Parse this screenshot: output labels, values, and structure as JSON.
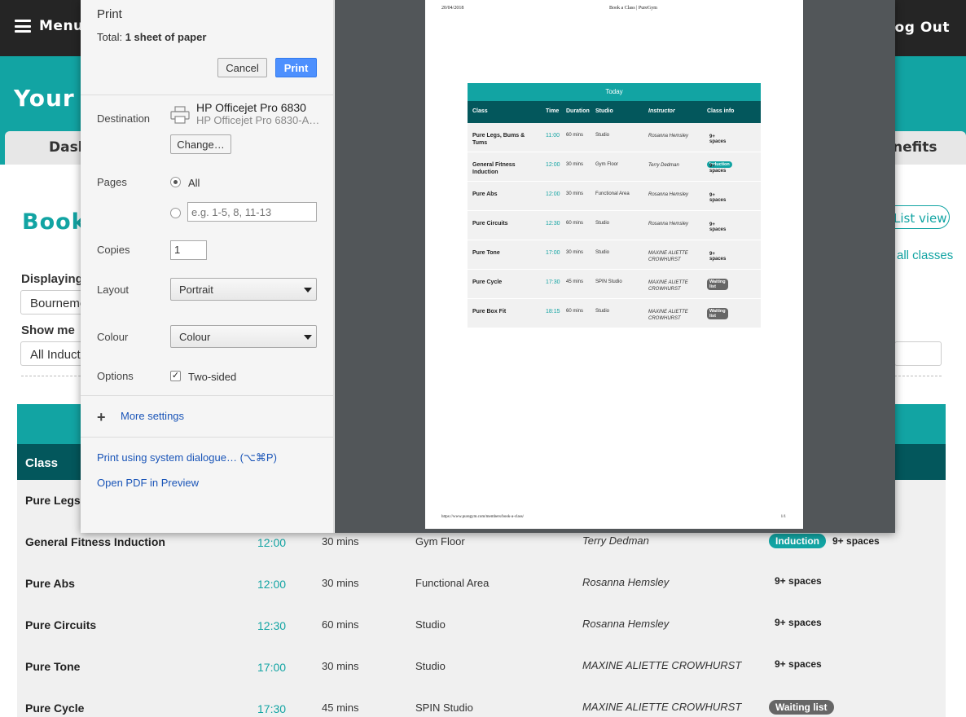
{
  "topbar": {
    "menu_label": "Menu",
    "logout_label": "Log Out"
  },
  "hero": {
    "title_partial": "Your m"
  },
  "tabs": {
    "dashboard_partial": "Dash",
    "benefits_partial": "nefits"
  },
  "book": {
    "title_partial": "Book",
    "list_view_partial": "List view",
    "all_classes_partial": "all classes",
    "displaying_label": "Displaying",
    "displaying_value": "Bournemouth",
    "show_me_label": "Show me",
    "show_me_value": "All Inductions"
  },
  "table": {
    "class_header": "Class",
    "today_label": "Today",
    "headers": {
      "class": "Class",
      "time": "Time",
      "duration": "Duration",
      "studio": "Studio",
      "instructor": "Instructor",
      "class_info": "Class info"
    },
    "rows": [
      {
        "class": "Pure Legs, Bums & Tums",
        "time": "11:00",
        "duration": "60 mins",
        "studio": "Studio",
        "instructor": "Rosanna Hemsley",
        "badge": "",
        "spaces": "9+ spaces"
      },
      {
        "class": "General Fitness Induction",
        "time": "12:00",
        "duration": "30 mins",
        "studio": "Gym Floor",
        "instructor": "Terry Dedman",
        "badge": "Induction",
        "spaces": "9+ spaces"
      },
      {
        "class": "Pure Abs",
        "time": "12:00",
        "duration": "30 mins",
        "studio": "Functional Area",
        "instructor": "Rosanna Hemsley",
        "badge": "",
        "spaces": "9+ spaces"
      },
      {
        "class": "Pure Circuits",
        "time": "12:30",
        "duration": "60 mins",
        "studio": "Studio",
        "instructor": "Rosanna Hemsley",
        "badge": "",
        "spaces": "9+ spaces"
      },
      {
        "class": "Pure Tone",
        "time": "17:00",
        "duration": "30 mins",
        "studio": "Studio",
        "instructor": "MAXINE ALIETTE CROWHURST",
        "badge": "",
        "spaces": "9+ spaces"
      },
      {
        "class": "Pure Cycle",
        "time": "17:30",
        "duration": "45 mins",
        "studio": "SPIN Studio",
        "instructor": "MAXINE ALIETTE CROWHURST",
        "badge": "Waiting list",
        "spaces": ""
      },
      {
        "class": "Pure Box Fit",
        "time": "18:15",
        "duration": "60 mins",
        "studio": "Studio",
        "instructor": "MAXINE ALIETTE CROWHURST",
        "badge": "Waiting list",
        "spaces": ""
      }
    ],
    "bg_first_class_partial": "Pure Legs"
  },
  "print_dialog": {
    "title": "Print",
    "total_label": "Total:",
    "total_value": "1 sheet of paper",
    "cancel_label": "Cancel",
    "print_label": "Print",
    "destination_label": "Destination",
    "printer_name": "HP Officejet Pro 6830",
    "printer_sub": "HP Officejet Pro 6830-A…",
    "change_label": "Change…",
    "pages_label": "Pages",
    "pages_all": "All",
    "pages_placeholder": "e.g. 1-5, 8, 11-13",
    "copies_label": "Copies",
    "copies_value": "1",
    "layout_label": "Layout",
    "layout_value": "Portrait",
    "colour_label": "Colour",
    "colour_value": "Colour",
    "options_label": "Options",
    "two_sided_label": "Two-sided",
    "two_sided_checked": true,
    "more_settings": "More settings",
    "system_dialogue": "Print using system dialogue… (⌥⌘P)",
    "open_pdf": "Open PDF in Preview"
  },
  "preview_sheet": {
    "date": "20/04/2018",
    "header_title": "Book a Class | PureGym",
    "footer_url": "https://www.puregym.com/members/book-a-class/",
    "page_num": "1/1"
  },
  "colors": {
    "brand_teal": "#12a4a3",
    "dark_teal": "#03575c",
    "topbar": "#252525",
    "print_blue": "#4d90fe",
    "waiting_gray": "#666666"
  },
  "icons": [
    "menu-icon",
    "printer-icon",
    "plus-icon",
    "dropdown-caret-icon",
    "checkbox-check-icon"
  ]
}
